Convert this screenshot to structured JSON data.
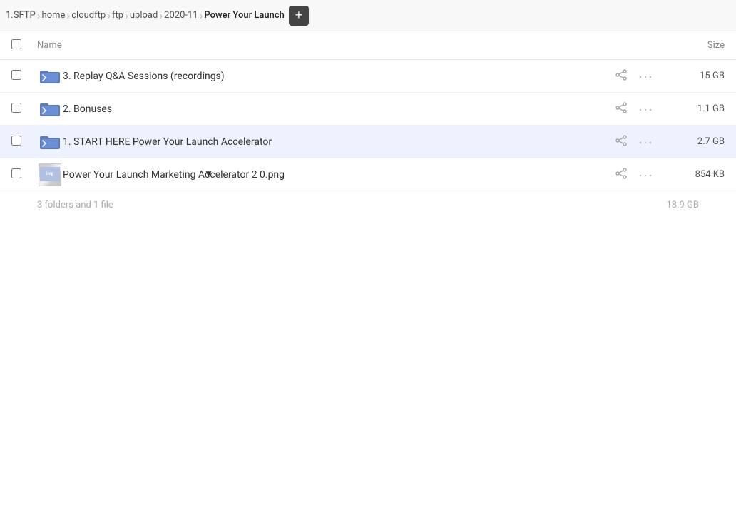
{
  "breadcrumb": {
    "items": [
      {
        "label": "1.SFTP",
        "active": false
      },
      {
        "label": "home",
        "active": false
      },
      {
        "label": "cloudftp",
        "active": false
      },
      {
        "label": "ftp",
        "active": false
      },
      {
        "label": "upload",
        "active": false
      },
      {
        "label": "2020-11",
        "active": false
      },
      {
        "label": "Power Your Launch",
        "active": true
      }
    ],
    "add_button_label": "+"
  },
  "table": {
    "col_name": "Name",
    "col_size": "Size"
  },
  "files": [
    {
      "id": "row1",
      "type": "folder",
      "name": "3. Replay Q&A Sessions (recordings)",
      "size": "15 GB"
    },
    {
      "id": "row2",
      "type": "folder",
      "name": "2. Bonuses",
      "size": "1.1 GB"
    },
    {
      "id": "row3",
      "type": "folder",
      "name": "1. START HERE Power Your Launch Accelerator",
      "size": "2.7 GB",
      "highlighted": true
    },
    {
      "id": "row4",
      "type": "png",
      "name": "Power Your Launch Marketing Accelerator 2 0.png",
      "size": "854 KB"
    }
  ],
  "summary": {
    "left": "3 folders and 1 file",
    "right": "18.9 GB"
  },
  "icons": {
    "share": "⬡",
    "more": "···",
    "share_char": "↗",
    "dots": "•••"
  }
}
